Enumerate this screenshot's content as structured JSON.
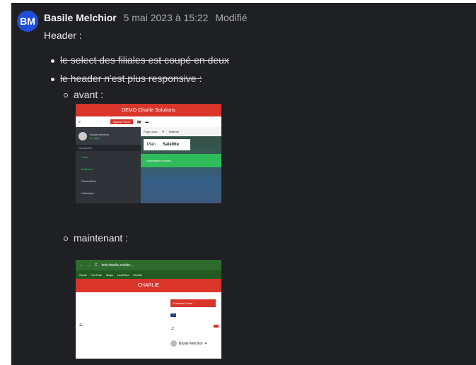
{
  "message": {
    "avatar_initials": "BM",
    "author": "Basile Melchior",
    "date": "5 mai 2023 à 15:22",
    "edited": "Modifié",
    "heading": "Header :",
    "items": [
      {
        "text": "le select des filiales est coupé en deux"
      },
      {
        "text": "le header n'est plus responsive :"
      }
    ],
    "sub_items": [
      {
        "label": "avant :"
      },
      {
        "label": "maintenant :"
      }
    ]
  },
  "screenshot_before": {
    "title": "DEMO Charlie Solutions",
    "agency": "Agence Paris",
    "user_name": "Basile Melchior",
    "user_status": "En ligne",
    "nav_label": "Navigation",
    "menu": [
      "Carte",
      "Matériels",
      "Paramètres",
      "Historique"
    ],
    "map_tab": "Page d'acc",
    "map_type": "Matériel",
    "plan": "Plan",
    "satellite": "Satellite",
    "inventory": "7 inventaires trouvés"
  },
  "screenshot_after": {
    "url": "test.charlie-solutio...",
    "bookmarks": [
      "Gmail",
      "YouTube",
      "Maps",
      "LastPass",
      "Charlie"
    ],
    "title": "CHARLIE",
    "select": "Foucauld Cons...",
    "user_name": "Basile Melchior"
  },
  "colors": {
    "background": "#1f2023",
    "avatar": "#1e4fd6",
    "brand_red": "#d9352b",
    "success_green": "#2ebd5a"
  }
}
